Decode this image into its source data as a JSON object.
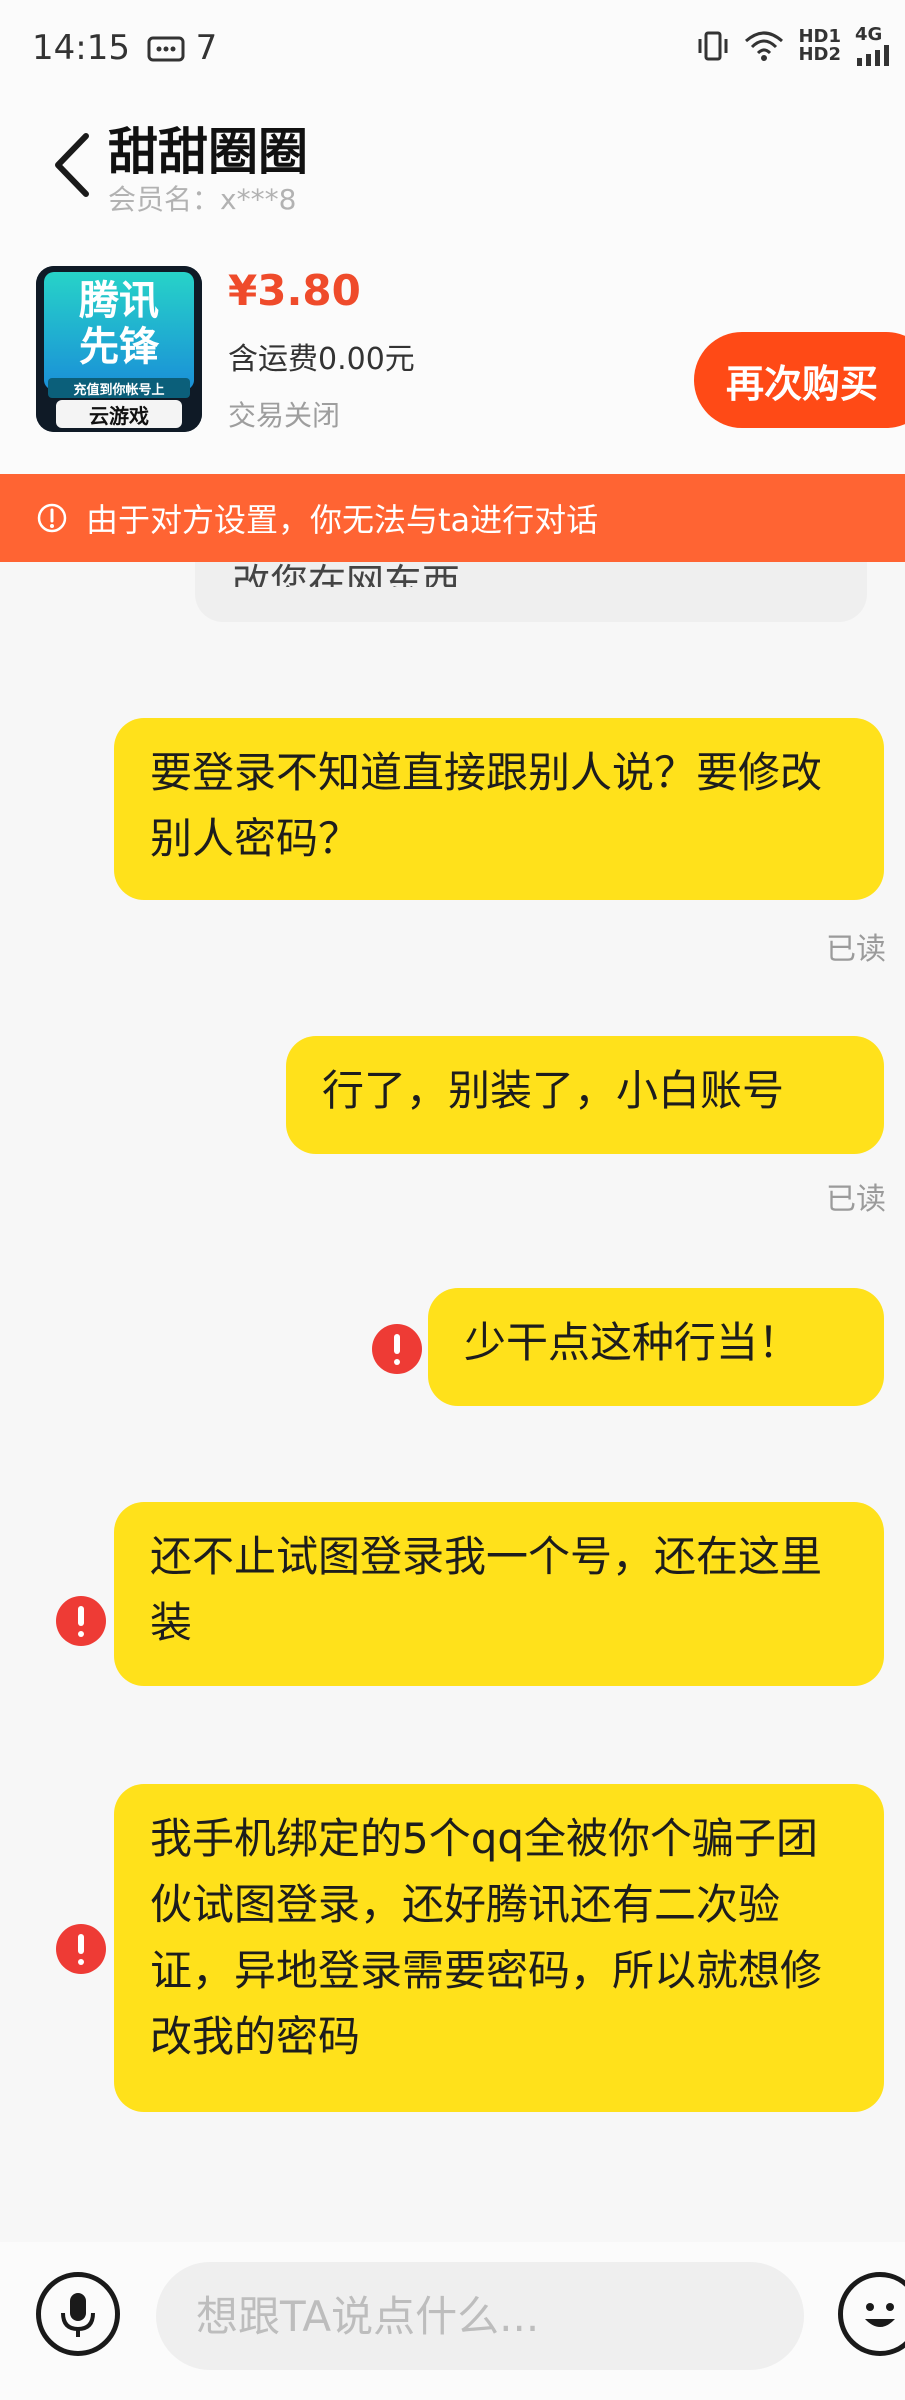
{
  "status_bar": {
    "time": "14:15",
    "notification_count": "7",
    "network_hd1": "HD1",
    "network_hd2": "HD2",
    "network_type": "4G"
  },
  "header": {
    "title": "甜甜圈圈",
    "subtitle": "会员名：x***8"
  },
  "product": {
    "image_lines": [
      "腾讯",
      "先锋"
    ],
    "image_caption": "充值到你帐号上",
    "image_footer": "云游戏",
    "price": "¥3.80",
    "shipping": "含运费0.00元",
    "status": "交易关闭",
    "rebuy_label": "再次购买"
  },
  "warning": {
    "text": "由于对方设置，你无法与ta进行对话",
    "color": "#ff6433"
  },
  "chat": {
    "peek_text": "改您在网东西",
    "messages": [
      {
        "text": "要登录不知道直接跟别人说？要修改别人密码？",
        "read": "已读",
        "error": false
      },
      {
        "text": "行了，别装了，小白账号",
        "read": "已读",
        "error": false
      },
      {
        "text": "少干点这种行当！",
        "read": "",
        "error": true
      },
      {
        "text": "还不止试图登录我一个号，还在这里装",
        "read": "",
        "error": true
      },
      {
        "text": "我手机绑定的5个qq全被你个骗子团伙试图登录，还好腾讯还有二次验证，异地登录需要密码，所以就想修改我的密码",
        "read": "",
        "error": true
      }
    ]
  },
  "input": {
    "placeholder": "想跟TA说点什么..."
  },
  "colors": {
    "bubble": "#ffe11b",
    "price": "#ef4b2b",
    "accent": "#ff4a16",
    "error": "#ee3b35"
  }
}
